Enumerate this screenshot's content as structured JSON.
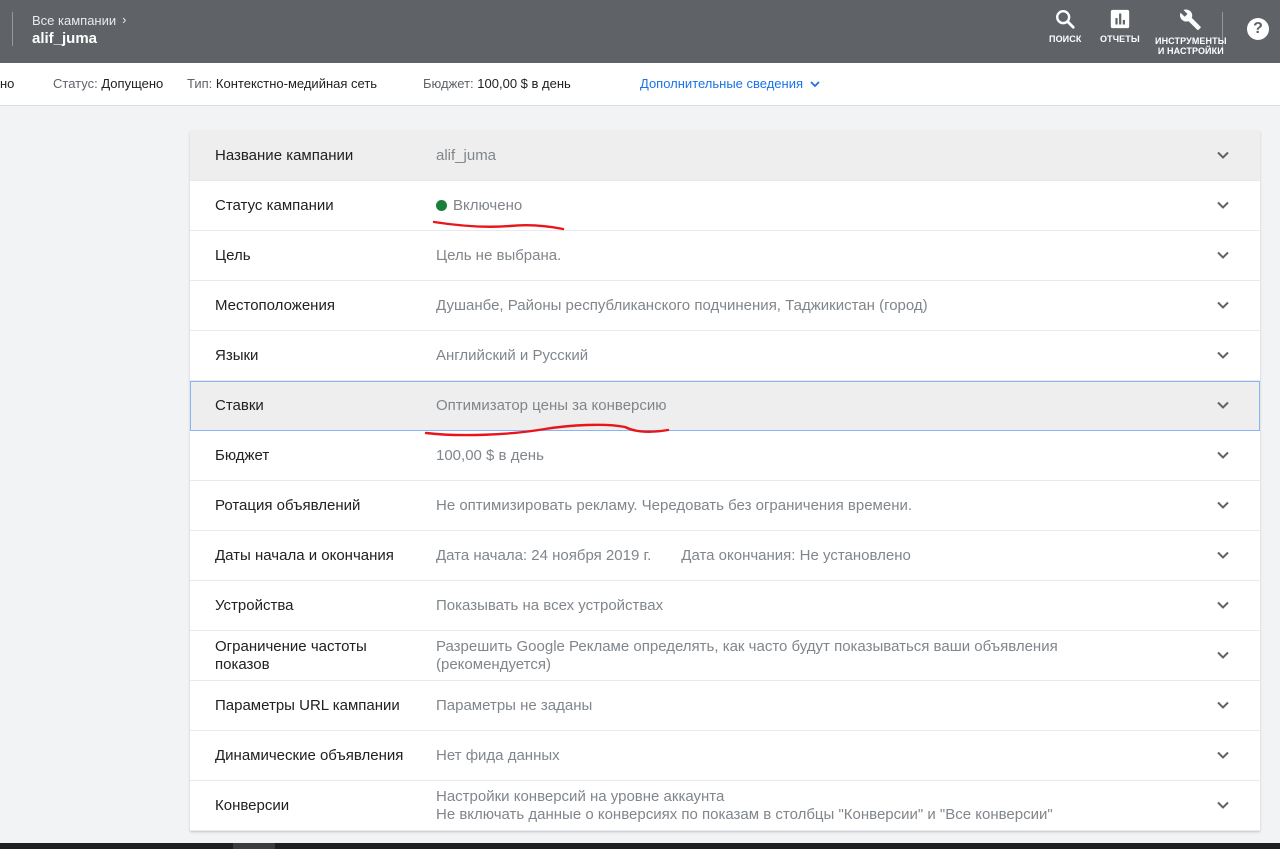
{
  "header": {
    "breadcrumb": "Все кампании",
    "campaign_name": "alif_juma",
    "tools": {
      "search": "ПОИСК",
      "reports": "ОТЧЕТЫ",
      "tools_line1": "ИНСТРУМЕНТЫ",
      "tools_line2": "И НАСТРОЙКИ"
    },
    "help_icon": "?"
  },
  "status_bar": {
    "cut_text": "но",
    "status_label": "Статус:",
    "status_value": "Допущено",
    "type_label": "Тип:",
    "type_value": "Контекстно-медийная сеть",
    "budget_label": "Бюджет:",
    "budget_value": "100,00 $ в день",
    "more_link": "Дополнительные сведения"
  },
  "settings": {
    "rows": [
      {
        "name": "Название кампании",
        "value": "alif_juma"
      },
      {
        "name": "Статус кампании",
        "value": "Включено"
      },
      {
        "name": "Цель",
        "value": "Цель не выбрана."
      },
      {
        "name": "Местоположения",
        "value": "Душанбе, Районы республиканского подчинения, Таджикистан (город)"
      },
      {
        "name": "Языки",
        "value": "Английский и Русский"
      },
      {
        "name": "Ставки",
        "value": "Оптимизатор цены за конверсию"
      },
      {
        "name": "Бюджет",
        "value": "100,00 $ в день"
      },
      {
        "name": "Ротация объявлений",
        "value": "Не оптимизировать рекламу. Чередовать без ограничения времени."
      },
      {
        "name": "Даты начала и окончания",
        "value": "Дата начала: 24 ноября 2019 г.",
        "value2": "Дата окончания: Не установлено"
      },
      {
        "name": "Устройства",
        "value": "Показывать на всех устройствах"
      },
      {
        "name": "Ограничение частоты показов",
        "value": "Разрешить Google Рекламе определять, как часто будут показываться ваши объявления (рекомендуется)"
      },
      {
        "name": "Параметры URL кампании",
        "value": "Параметры не заданы"
      },
      {
        "name": "Динамические объявления",
        "value": "Нет фида данных"
      },
      {
        "name": "Конверсии",
        "value": "Настройки конверсий на уровне аккаунта",
        "value2": "Не включать данные о конверсиях по показам в столбцы \"Конверсии\" и \"Все конверсии\""
      }
    ]
  },
  "colors": {
    "header_bg": "#5f6368",
    "status_enabled": "#188038",
    "link": "#1a73e8",
    "annotation": "#e8161b"
  }
}
